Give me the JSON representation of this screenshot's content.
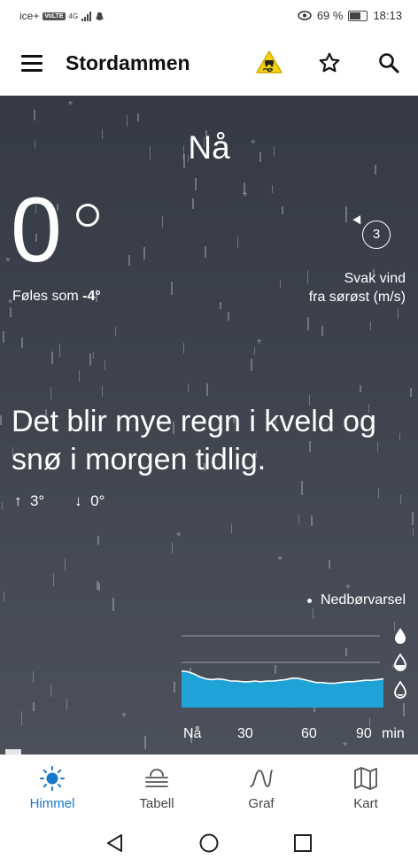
{
  "status_bar": {
    "carrier": "ice+",
    "volte": "VoLTE",
    "network": "4G",
    "battery": "69 %",
    "time": "18:13"
  },
  "app_bar": {
    "title": "Stordammen",
    "icons": [
      "menu-icon",
      "slippery-road-warning-icon",
      "star-icon",
      "search-icon"
    ],
    "warning_color": "#f5d20a"
  },
  "weather": {
    "period": "Nå",
    "temperature": "0",
    "feels_like_label": "Føles som ",
    "feels_like_value": "-4°",
    "wind_speed": "3",
    "wind_label_line1": "Svak vind",
    "wind_label_line2": "fra sørøst (m/s)",
    "headline": "Det blir mye regn i kveld og snø i morgen tidlig.",
    "high": "3°",
    "low": "0°"
  },
  "precipitation": {
    "label": "Nedbørvarsel",
    "x_labels": [
      "Nå",
      "30",
      "60",
      "90",
      "min"
    ],
    "fill_color": "#1fa3d6",
    "series_fraction": [
      0.51,
      0.5,
      0.47,
      0.43,
      0.4,
      0.39,
      0.4,
      0.39,
      0.37,
      0.37,
      0.36,
      0.36,
      0.37,
      0.36,
      0.37,
      0.37,
      0.38,
      0.39,
      0.41,
      0.41,
      0.39,
      0.37,
      0.35,
      0.35,
      0.34,
      0.34,
      0.35,
      0.36,
      0.36,
      0.37,
      0.38,
      0.38,
      0.39,
      0.4
    ]
  },
  "tabs": [
    {
      "label": "Himmel",
      "icon": "sun-icon",
      "active": true
    },
    {
      "label": "Tabell",
      "icon": "table-icon",
      "active": false
    },
    {
      "label": "Graf",
      "icon": "graph-icon",
      "active": false
    },
    {
      "label": "Kart",
      "icon": "map-icon",
      "active": false
    }
  ],
  "accent_color": "#1976c9"
}
